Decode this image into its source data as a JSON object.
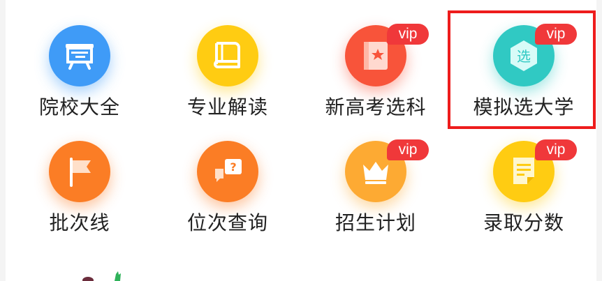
{
  "grid": {
    "items": [
      {
        "label": "院校大全",
        "icon": "blackboard-icon",
        "color": "#3f9bf7",
        "vip": false
      },
      {
        "label": "专业解读",
        "icon": "book-icon",
        "color": "#ffcc12",
        "vip": false
      },
      {
        "label": "新高考选科",
        "icon": "star-book-icon",
        "color": "#f8543a",
        "vip": true
      },
      {
        "label": "模拟选大学",
        "icon": "hexagon-select-icon",
        "color": "#30c9c3",
        "vip": true
      },
      {
        "label": "批次线",
        "icon": "flag-icon",
        "color": "#fb7d25",
        "vip": false
      },
      {
        "label": "位次查询",
        "icon": "question-chat-icon",
        "color": "#fb7d25",
        "vip": false
      },
      {
        "label": "招生计划",
        "icon": "crown-icon",
        "color": "#fdaa33",
        "vip": true
      },
      {
        "label": "录取分数",
        "icon": "note-icon",
        "color": "#ffcc12",
        "vip": true
      }
    ],
    "vip_label": "vip",
    "hexagon_char": "选",
    "highlight_color": "#ee1c1c",
    "vip_color": "#f0383a"
  }
}
